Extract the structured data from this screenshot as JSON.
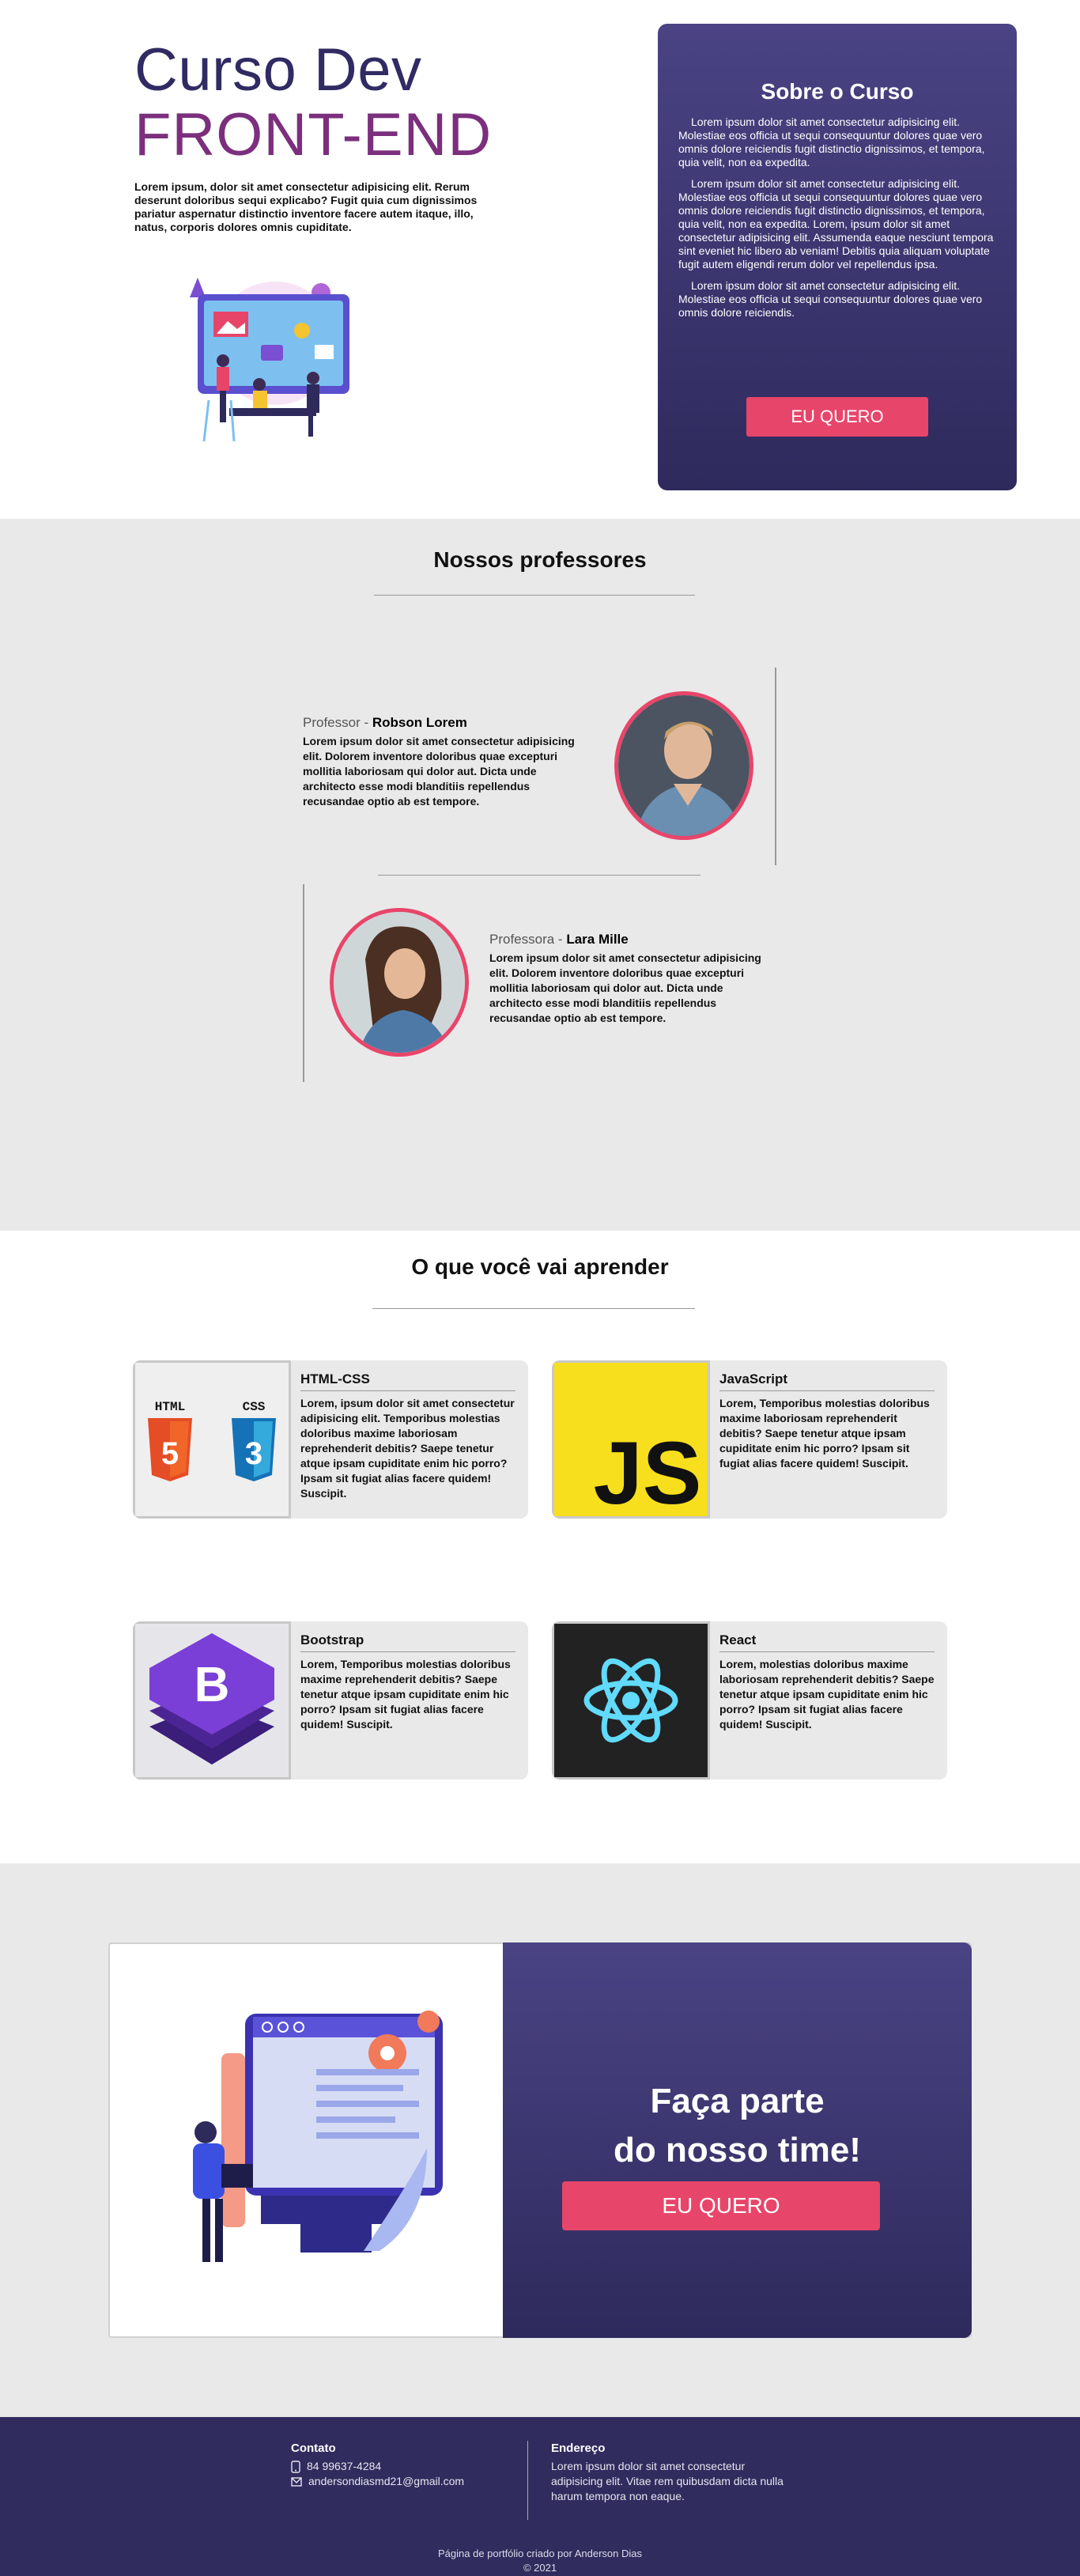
{
  "hero": {
    "title_line1": "Curso Dev",
    "title_line2": "FRONT-END",
    "text": "Lorem ipsum, dolor sit amet consectetur adipisicing elit. Rerum deserunt doloribus sequi explicabo? Fugit quia cum dignissimos pariatur aspernatur distinctio inventore facere autem itaque, illo, natus, corporis dolores omnis cupiditate."
  },
  "about": {
    "title": "Sobre o Curso",
    "paragraphs": [
      "Lorem ipsum dolor sit amet consectetur adipisicing elit. Molestiae eos officia ut sequi consequuntur dolores quae vero omnis dolore reiciendis fugit distinctio dignissimos, et tempora, quia velit, non ea expedita.",
      "Lorem ipsum dolor sit amet consectetur adipisicing elit. Molestiae eos officia ut sequi consequuntur dolores quae vero omnis dolore reiciendis fugit distinctio dignissimos, et tempora, quia velit, non ea expedita. Lorem, ipsum dolor sit amet consectetur adipisicing elit. Assumenda eaque nesciunt tempora sint eveniet hic libero ab veniam! Debitis quia aliquam voluptate fugit autem eligendi rerum dolor vel repellendus ipsa.",
      "Lorem ipsum dolor sit amet consectetur adipisicing elit. Molestiae eos officia ut sequi consequuntur dolores quae vero omnis dolore reiciendis."
    ],
    "button": "EU QUERO"
  },
  "professors": {
    "title": "Nossos professores",
    "items": [
      {
        "role": "Professor - ",
        "name": "Robson Lorem",
        "desc": "Lorem ipsum dolor sit amet consectetur adipisicing elit. Dolorem inventore doloribus quae excepturi mollitia laboriosam qui dolor aut. Dicta unde architecto esse modi blanditiis repellendus recusandae optio ab est tempore."
      },
      {
        "role": "Professora - ",
        "name": "Lara Mille",
        "desc": "Lorem ipsum dolor sit amet consectetur adipisicing elit. Dolorem inventore doloribus quae excepturi mollitia laboriosam qui dolor aut. Dicta unde architecto esse modi blanditiis repellendus recusandae optio ab est tempore."
      }
    ]
  },
  "learn": {
    "title": "O que você vai aprender",
    "items": [
      {
        "title": "HTML-CSS",
        "desc": "Lorem, ipsum dolor sit amet consectetur adipisicing elit. Temporibus molestias doloribus maxime laboriosam reprehenderit debitis? Saepe tenetur atque ipsam cupiditate enim hic porro? Ipsam sit fugiat alias facere quidem! Suscipit.",
        "logo_text_1": "HTML",
        "logo_text_2": "CSS"
      },
      {
        "title": "JavaScript",
        "desc": "Lorem, Temporibus molestias doloribus maxime laboriosam reprehenderit debitis? Saepe tenetur atque ipsam cupiditate enim hic porro? Ipsam sit fugiat alias facere quidem! Suscipit.",
        "logo_text": "JS"
      },
      {
        "title": "Bootstrap",
        "desc": "Lorem, Temporibus molestias doloribus maxime reprehenderit debitis? Saepe tenetur atque ipsam cupiditate enim hic porro? Ipsam sit fugiat alias facere quidem! Suscipit.",
        "logo_text": "B"
      },
      {
        "title": "React",
        "desc": "Lorem, molestias doloribus maxime laboriosam reprehenderit debitis? Saepe tenetur atque ipsam cupiditate enim hic porro? Ipsam sit fugiat alias facere quidem! Suscipit."
      }
    ]
  },
  "cta": {
    "title_line1": "Faça parte",
    "title_line2": "do nosso time!",
    "button": "EU QUERO"
  },
  "footer": {
    "contact_title": "Contato",
    "phone": "84 99637-4284",
    "email": "andersondiasmd21@gmail.com",
    "address_title": "Endereço",
    "address": "Lorem ipsum dolor sit amet consectetur adipisicing elit. Vitae rem quibusdam dicta nulla harum tempora non eaque.",
    "credit": "Página de portfólio criado por Anderson Dias",
    "copyright": "© 2021"
  },
  "colors": {
    "navy": "#302b63",
    "purple": "#7b2f7d",
    "card_gradient_top": "#4a4384",
    "card_gradient_bottom": "#2e2a5c",
    "pink": "#e8456a",
    "gray_bg": "#e9e9e9",
    "footer_bg": "#302c5e"
  }
}
